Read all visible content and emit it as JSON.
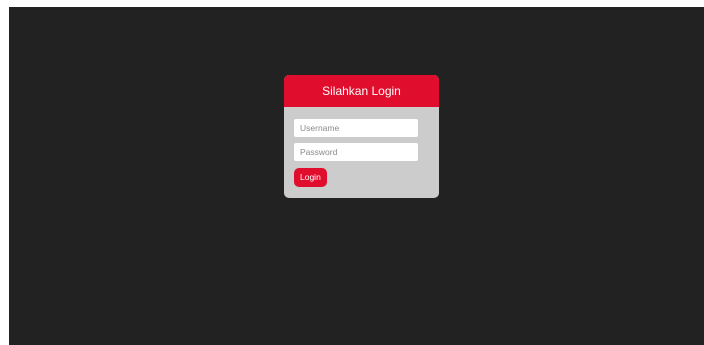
{
  "login_form": {
    "title": "Silahkan Login",
    "username_placeholder": "Username",
    "password_placeholder": "Password",
    "login_label": "Login"
  },
  "colors": {
    "background": "#222222",
    "card": "#cccccc",
    "accent": "#e00d2c"
  }
}
